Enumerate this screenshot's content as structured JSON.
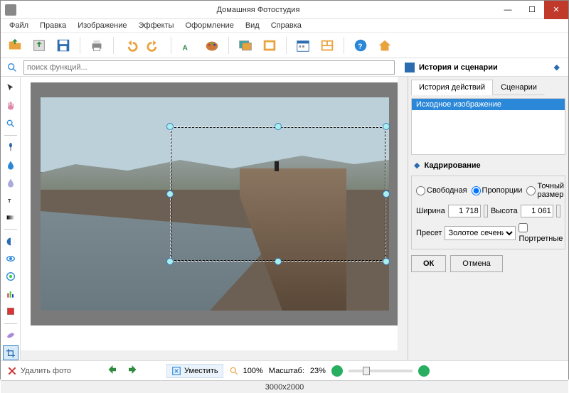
{
  "window": {
    "title": "Домашняя Фотостудия"
  },
  "menu": {
    "items": [
      "Файл",
      "Правка",
      "Изображение",
      "Эффекты",
      "Оформление",
      "Вид",
      "Справка"
    ]
  },
  "search": {
    "placeholder": "поиск функций..."
  },
  "history_panel": {
    "title": "История и сценарии",
    "tabs": {
      "history": "История действий",
      "scenarios": "Сценарии"
    },
    "items": [
      "Исходное изображение"
    ]
  },
  "crop_panel": {
    "title": "Кадрирование",
    "mode_free": "Свободная",
    "mode_prop": "Пропорции",
    "mode_exact": "Точный размер",
    "width_label": "Ширина",
    "width_value": "1 718",
    "height_label": "Высота",
    "height_value": "1 061",
    "preset_label": "Пресет",
    "preset_value": "Золотое сечени",
    "portrait_label": "Портретные",
    "ok": "ОК",
    "cancel": "Отмена"
  },
  "footer": {
    "delete": "Удалить фото",
    "fit": "Уместить",
    "zoom100": "100%",
    "scale_label": "Масштаб:",
    "scale_value": "23%"
  },
  "statusbar": {
    "dimensions": "3000x2000"
  },
  "toolbar_icons": [
    "open",
    "export",
    "save",
    "print",
    "undo",
    "redo",
    "text",
    "palette",
    "gallery",
    "frames",
    "calendar",
    "collage",
    "help",
    "home"
  ],
  "left_tools": [
    "pointer",
    "hand",
    "zoom",
    "brush-round",
    "drop",
    "blur",
    "text-t",
    "gradient",
    "contrast",
    "eye",
    "reduce",
    "levels",
    "details",
    "heal",
    "crop"
  ]
}
